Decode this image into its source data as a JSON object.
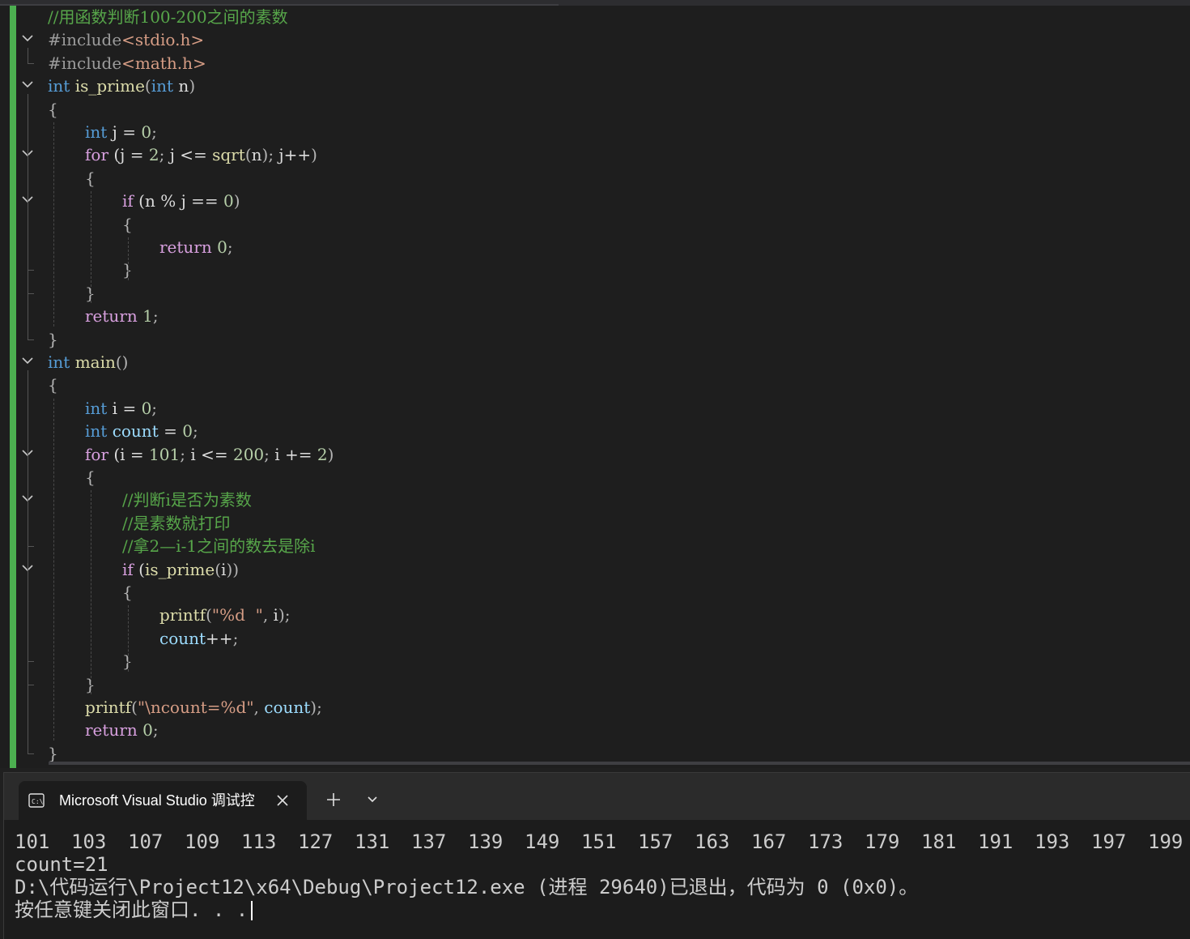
{
  "editor": {
    "lines": [
      {
        "row": 0,
        "indent": 0,
        "fold": false,
        "tokens": [
          [
            "cm",
            "//用函数判断100-200之间的素数"
          ]
        ]
      },
      {
        "row": 1,
        "indent": 0,
        "fold": true,
        "tokens": [
          [
            "pp",
            "#include"
          ],
          [
            "str",
            "<stdio.h>"
          ]
        ]
      },
      {
        "row": 2,
        "indent": 0,
        "fold": false,
        "tokens": [
          [
            "pp",
            "#include"
          ],
          [
            "str",
            "<math.h>"
          ]
        ]
      },
      {
        "row": 3,
        "indent": 0,
        "fold": true,
        "tokens": [
          [
            "kw",
            "int"
          ],
          [
            "",
            "",
            " "
          ],
          [
            "fn",
            "is_prime"
          ],
          [
            "pu",
            "("
          ],
          [
            "kw",
            "int"
          ],
          [
            "",
            "",
            " "
          ],
          [
            "",
            "n"
          ],
          [
            "pu",
            ")"
          ]
        ]
      },
      {
        "row": 4,
        "indent": 0,
        "fold": false,
        "tokens": [
          [
            "pu",
            "{"
          ]
        ]
      },
      {
        "row": 5,
        "indent": 1,
        "fold": false,
        "tokens": [
          [
            "kw",
            "int"
          ],
          [
            "",
            " j = "
          ],
          [
            "num",
            "0"
          ],
          [
            "pu",
            ";"
          ]
        ]
      },
      {
        "row": 6,
        "indent": 1,
        "fold": true,
        "tokens": [
          [
            "kw2",
            "for"
          ],
          [
            "",
            " (j = "
          ],
          [
            "num",
            "2"
          ],
          [
            "pu",
            ";"
          ],
          [
            "",
            " j <= "
          ],
          [
            "fn",
            "sqrt"
          ],
          [
            "pu",
            "("
          ],
          [
            "",
            "n"
          ],
          [
            "pu",
            ")"
          ],
          [
            "pu",
            ";"
          ],
          [
            "",
            " j++"
          ],
          [
            "pu",
            ")"
          ]
        ]
      },
      {
        "row": 7,
        "indent": 1,
        "fold": false,
        "tokens": [
          [
            "pu",
            "{"
          ]
        ]
      },
      {
        "row": 8,
        "indent": 2,
        "fold": true,
        "tokens": [
          [
            "kw2",
            "if"
          ],
          [
            "",
            " (n % j == "
          ],
          [
            "num",
            "0"
          ],
          [
            "pu",
            ")"
          ]
        ]
      },
      {
        "row": 9,
        "indent": 2,
        "fold": false,
        "tokens": [
          [
            "pu",
            "{"
          ]
        ]
      },
      {
        "row": 10,
        "indent": 3,
        "fold": false,
        "tokens": [
          [
            "kw2",
            "return"
          ],
          [
            "",
            " "
          ],
          [
            "num",
            "0"
          ],
          [
            "pu",
            ";"
          ]
        ]
      },
      {
        "row": 11,
        "indent": 2,
        "fold": false,
        "tokens": [
          [
            "pu",
            "}"
          ]
        ]
      },
      {
        "row": 12,
        "indent": 1,
        "fold": false,
        "tokens": [
          [
            "pu",
            "}"
          ]
        ]
      },
      {
        "row": 13,
        "indent": 1,
        "fold": false,
        "tokens": [
          [
            "kw2",
            "return"
          ],
          [
            "",
            " "
          ],
          [
            "num",
            "1"
          ],
          [
            "pu",
            ";"
          ]
        ]
      },
      {
        "row": 14,
        "indent": 0,
        "fold": false,
        "tokens": [
          [
            "pu",
            "}"
          ]
        ]
      },
      {
        "row": 15,
        "indent": 0,
        "fold": true,
        "tokens": [
          [
            "kw",
            "int"
          ],
          [
            "",
            " "
          ],
          [
            "fn",
            "main"
          ],
          [
            "pu",
            "()"
          ]
        ]
      },
      {
        "row": 16,
        "indent": 0,
        "fold": false,
        "tokens": [
          [
            "pu",
            "{"
          ]
        ]
      },
      {
        "row": 17,
        "indent": 1,
        "fold": false,
        "tokens": [
          [
            "kw",
            "int"
          ],
          [
            "",
            " i = "
          ],
          [
            "num",
            "0"
          ],
          [
            "pu",
            ";"
          ]
        ]
      },
      {
        "row": 18,
        "indent": 1,
        "fold": false,
        "tokens": [
          [
            "kw",
            "int"
          ],
          [
            "",
            " "
          ],
          [
            "var",
            "count"
          ],
          [
            "",
            " = "
          ],
          [
            "num",
            "0"
          ],
          [
            "pu",
            ";"
          ]
        ]
      },
      {
        "row": 19,
        "indent": 1,
        "fold": true,
        "tokens": [
          [
            "kw2",
            "for"
          ],
          [
            "",
            " (i = "
          ],
          [
            "num",
            "101"
          ],
          [
            "pu",
            ";"
          ],
          [
            "",
            " i <= "
          ],
          [
            "num",
            "200"
          ],
          [
            "pu",
            ";"
          ],
          [
            "",
            " i += "
          ],
          [
            "num",
            "2"
          ],
          [
            "pu",
            ")"
          ]
        ]
      },
      {
        "row": 20,
        "indent": 1,
        "fold": false,
        "tokens": [
          [
            "pu",
            "{"
          ]
        ]
      },
      {
        "row": 21,
        "indent": 2,
        "fold": true,
        "tokens": [
          [
            "cm",
            "//判断i是否为素数"
          ]
        ]
      },
      {
        "row": 22,
        "indent": 2,
        "fold": false,
        "tokens": [
          [
            "cm",
            "//是素数就打印"
          ]
        ]
      },
      {
        "row": 23,
        "indent": 2,
        "fold": false,
        "tokens": [
          [
            "cm",
            "//拿2—i-1之间的数去是除i"
          ]
        ]
      },
      {
        "row": 24,
        "indent": 2,
        "fold": true,
        "tokens": [
          [
            "kw2",
            "if"
          ],
          [
            "",
            " ("
          ],
          [
            "fn",
            "is_prime"
          ],
          [
            "pu",
            "("
          ],
          [
            "",
            "i"
          ],
          [
            "pu",
            "))"
          ]
        ]
      },
      {
        "row": 25,
        "indent": 2,
        "fold": false,
        "tokens": [
          [
            "pu",
            "{"
          ]
        ]
      },
      {
        "row": 26,
        "indent": 3,
        "fold": false,
        "tokens": [
          [
            "fn",
            "printf"
          ],
          [
            "pu",
            "("
          ],
          [
            "str",
            "\"%d  \""
          ],
          [
            "pu",
            ","
          ],
          [
            "",
            " i"
          ],
          [
            "pu",
            ")"
          ],
          [
            "pu",
            ";"
          ]
        ]
      },
      {
        "row": 27,
        "indent": 3,
        "fold": false,
        "tokens": [
          [
            "var",
            "count"
          ],
          [
            "",
            "++"
          ],
          [
            "pu",
            ";"
          ]
        ]
      },
      {
        "row": 28,
        "indent": 2,
        "fold": false,
        "tokens": [
          [
            "pu",
            "}"
          ]
        ]
      },
      {
        "row": 29,
        "indent": 1,
        "fold": false,
        "tokens": [
          [
            "pu",
            "}"
          ]
        ]
      },
      {
        "row": 30,
        "indent": 1,
        "fold": false,
        "tokens": [
          [
            "fn",
            "printf"
          ],
          [
            "pu",
            "("
          ],
          [
            "str",
            "\"\\ncount=%d\""
          ],
          [
            "pu",
            ","
          ],
          [
            "",
            " "
          ],
          [
            "var",
            "count"
          ],
          [
            "pu",
            ")"
          ],
          [
            "pu",
            ";"
          ]
        ]
      },
      {
        "row": 31,
        "indent": 1,
        "fold": false,
        "tokens": [
          [
            "kw2",
            "return"
          ],
          [
            "",
            " "
          ],
          [
            "num",
            "0"
          ],
          [
            "pu",
            ";"
          ]
        ]
      },
      {
        "row": 32,
        "indent": 0,
        "fold": false,
        "tokens": [
          [
            "pu",
            "}"
          ]
        ]
      }
    ]
  },
  "terminal": {
    "tab_icon": "console-icon",
    "tab_title": "Microsoft Visual Studio 调试控",
    "close_icon": "close-icon",
    "new_tab_icon": "plus-icon",
    "dropdown_icon": "chevron-down-icon",
    "primes": [
      "101",
      "103",
      "107",
      "109",
      "113",
      "127",
      "131",
      "137",
      "139",
      "149",
      "151",
      "157",
      "163",
      "167",
      "173",
      "179",
      "181",
      "191",
      "193",
      "197",
      "199"
    ],
    "count_line": "count=21",
    "exit_line": "D:\\代码运行\\Project12\\x64\\Debug\\Project12.exe (进程 29640)已退出，代码为 0 (0x0)。",
    "prompt_line": "按任意键关闭此窗口. . ."
  },
  "colors": {
    "editor_bg": "#1e1e1e",
    "keyword": "#569cd6",
    "control_keyword": "#d8a0df",
    "string": "#d69d85",
    "number": "#b5cea8",
    "comment": "#57a64a",
    "function": "#dcdcaa",
    "variable": "#9cdcfe",
    "change_bar": "#4caf50"
  }
}
